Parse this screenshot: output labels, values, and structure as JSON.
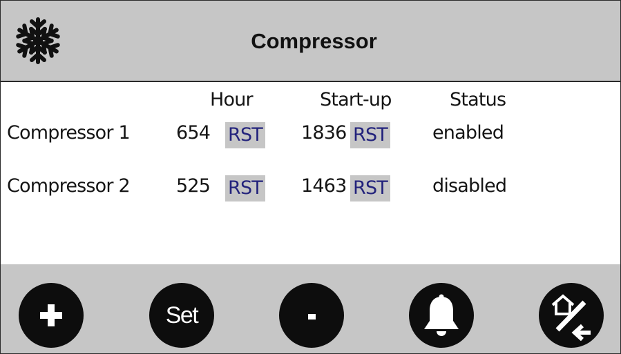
{
  "header": {
    "icon": "snowflake-icon",
    "title": "Compressor"
  },
  "columns": {
    "hour": "Hour",
    "startup": "Start-up",
    "status": "Status"
  },
  "rows": [
    {
      "name": "Compressor 1",
      "hours": "654",
      "hours_reset_label": "RST",
      "startups": "1836",
      "startups_reset_label": "RST",
      "status": "enabled"
    },
    {
      "name": "Compressor 2",
      "hours": "525",
      "hours_reset_label": "RST",
      "startups": "1463",
      "startups_reset_label": "RST",
      "status": "disabled"
    }
  ],
  "footer": {
    "buttons": [
      {
        "icon": "plus-icon"
      },
      {
        "label": "Set"
      },
      {
        "icon": "minus-icon"
      },
      {
        "icon": "bell-icon"
      },
      {
        "icon": "home-back-icon"
      }
    ]
  },
  "colors": {
    "panel_gray": "#c6c6c6",
    "rst_text": "#23237c",
    "button_fill": "#0d0d0d"
  }
}
